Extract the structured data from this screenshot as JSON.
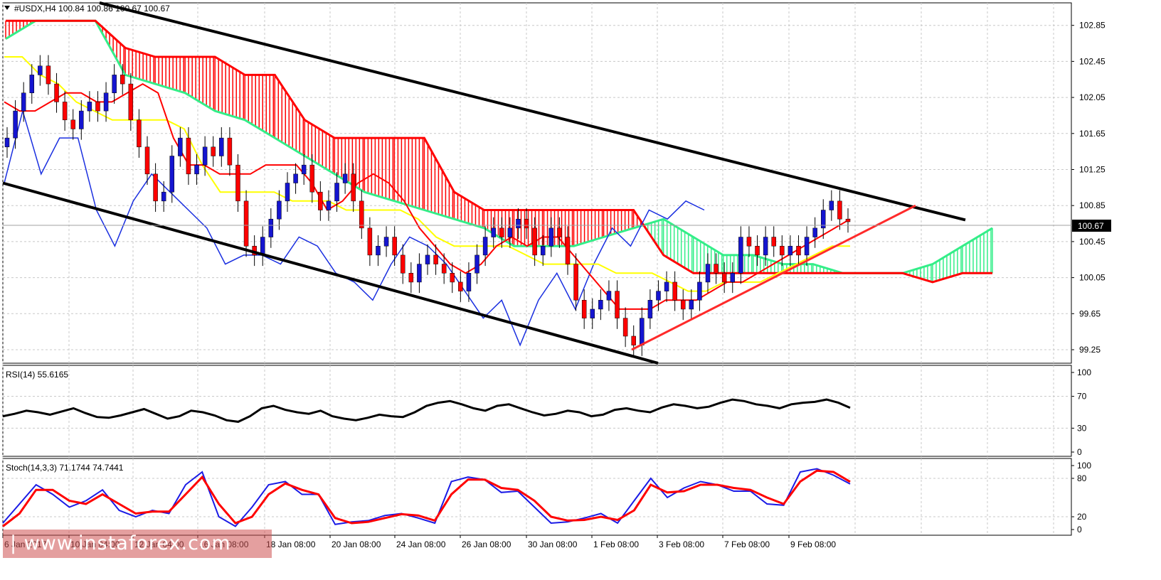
{
  "header": {
    "symbol_line": "#USDX,H4  100.84 100.86 100.67 100.67"
  },
  "colors": {
    "bull_candle": "#1515d0",
    "bear_candle": "#ff0000",
    "kumo_bear": "#ff0000",
    "kumo_bull": "#33ee88",
    "tenkan": "#ff0000",
    "kijun": "#ffff00",
    "chikou": "#1a2fe0",
    "channel": "#000000",
    "trendline": "#ff2a2a",
    "rsi_line": "#000000",
    "stoch_main": "#1a1ae6",
    "stoch_signal": "#ff0000"
  },
  "price_axis": {
    "ticks": [
      "102.85",
      "102.45",
      "102.05",
      "101.65",
      "101.25",
      "100.85",
      "100.45",
      "100.05",
      "99.65",
      "99.25"
    ],
    "current": "100.67"
  },
  "time_axis": [
    "6 Jan 2017",
    "10 Jan 04:00",
    "12 Jan 04:00",
    "16 Jan 08:00",
    "18 Jan 08:00",
    "20 Jan 08:00",
    "24 Jan 08:00",
    "26 Jan 08:00",
    "30 Jan 08:00",
    "1 Feb 08:00",
    "3 Feb 08:00",
    "7 Feb 08:00",
    "9 Feb 08:00"
  ],
  "rsi_panel": {
    "title": "RSI(14) 55.6165",
    "ticks": [
      "100",
      "70",
      "30",
      "0"
    ]
  },
  "stoch_panel": {
    "title": "Stoch(14,3,3) 71.1744 74.7441",
    "ticks": [
      "100",
      "80",
      "20",
      "0"
    ]
  },
  "watermark": "| www.instaforex.com",
  "chart_data": {
    "type": "candlestick",
    "symbol": "#USDX",
    "timeframe": "H4",
    "ohlc_last": {
      "open": 100.84,
      "high": 100.86,
      "low": 100.67,
      "close": 100.67
    },
    "ylim": [
      99.1,
      103.1
    ],
    "close_series": [
      101.6,
      101.9,
      102.1,
      102.3,
      102.4,
      102.2,
      102.0,
      101.8,
      101.7,
      101.9,
      102.0,
      101.9,
      102.1,
      102.3,
      102.2,
      101.8,
      101.5,
      101.2,
      100.9,
      101.0,
      101.4,
      101.6,
      101.2,
      101.3,
      101.5,
      101.4,
      101.6,
      101.3,
      100.9,
      100.4,
      100.3,
      100.5,
      100.7,
      100.9,
      101.1,
      101.2,
      101.3,
      101.0,
      100.8,
      100.9,
      101.1,
      101.2,
      100.9,
      100.6,
      100.3,
      100.4,
      100.5,
      100.3,
      100.1,
      100.0,
      100.2,
      100.3,
      100.2,
      100.1,
      100.0,
      99.9,
      100.1,
      100.3,
      100.5,
      100.6,
      100.5,
      100.6,
      100.7,
      100.6,
      100.3,
      100.4,
      100.6,
      100.5,
      100.2,
      99.8,
      99.6,
      99.7,
      99.8,
      99.9,
      99.6,
      99.4,
      99.3,
      99.6,
      99.8,
      99.9,
      100.0,
      99.8,
      99.7,
      99.8,
      100.0,
      100.2,
      100.1,
      100.0,
      100.1,
      100.5,
      100.4,
      100.3,
      100.5,
      100.4,
      100.3,
      100.4,
      100.3,
      100.5,
      100.6,
      100.8,
      100.9,
      100.7,
      100.67
    ],
    "tenkan": [
      102.0,
      101.9,
      101.9,
      102.0,
      102.1,
      102.1,
      102.0,
      102.0,
      102.1,
      102.2,
      102.1,
      101.6,
      101.3,
      101.3,
      101.2,
      101.2,
      101.2,
      101.3,
      101.3,
      101.3,
      101.1,
      100.8,
      100.9,
      101.1,
      101.2,
      101.1,
      100.9,
      100.6,
      100.4,
      100.2,
      100.1,
      100.2,
      100.4,
      100.5,
      100.4,
      100.5,
      100.5,
      100.3,
      100.1,
      99.9,
      99.7,
      99.7,
      99.7,
      99.8,
      99.8,
      99.8,
      99.9,
      100.0,
      100.0,
      100.1,
      100.2,
      100.3,
      100.4,
      100.5,
      100.6,
      100.7
    ],
    "kijun": [
      102.5,
      102.5,
      102.3,
      102.2,
      102.0,
      101.9,
      101.8,
      101.8,
      101.8,
      101.8,
      101.7,
      101.3,
      101.0,
      101.0,
      101.0,
      101.0,
      100.9,
      100.9,
      100.9,
      100.8,
      100.8,
      100.8,
      100.8,
      100.7,
      100.5,
      100.4,
      100.4,
      100.4,
      100.4,
      100.3,
      100.2,
      100.2,
      100.2,
      100.2,
      100.1,
      100.1,
      100.1,
      100.0,
      99.9,
      99.9,
      100.0,
      100.0,
      100.0,
      100.1,
      100.2,
      100.3,
      100.4,
      100.4
    ],
    "senkou_a": [
      102.7,
      102.9,
      102.9,
      102.9,
      102.3,
      102.2,
      102.1,
      101.9,
      101.8,
      101.6,
      101.4,
      101.2,
      101.0,
      100.9,
      100.8,
      100.7,
      100.6,
      100.4,
      100.4,
      100.4,
      100.5,
      100.6,
      100.7,
      100.5,
      100.3,
      100.3,
      100.2,
      100.2,
      100.1,
      100.1,
      100.1,
      100.2,
      100.4,
      100.6
    ],
    "senkou_b": [
      102.9,
      102.9,
      102.9,
      102.9,
      102.6,
      102.5,
      102.5,
      102.5,
      102.3,
      102.3,
      101.8,
      101.6,
      101.6,
      101.6,
      101.6,
      101.0,
      100.8,
      100.8,
      100.8,
      100.8,
      100.8,
      100.8,
      100.3,
      100.1,
      100.1,
      100.1,
      100.1,
      100.1,
      100.1,
      100.1,
      100.1,
      100.0,
      100.1,
      100.1
    ],
    "chikou": [
      101.1,
      101.9,
      101.2,
      101.6,
      101.6,
      100.8,
      100.4,
      100.9,
      101.2,
      101.0,
      100.8,
      100.6,
      100.2,
      100.3,
      100.3,
      100.2,
      100.5,
      100.4,
      100.1,
      100.0,
      99.8,
      100.2,
      100.5,
      100.4,
      100.2,
      99.9,
      99.6,
      99.8,
      99.3,
      99.8,
      100.1,
      99.7,
      100.2,
      100.6,
      100.4,
      100.8,
      100.7,
      100.9,
      100.8
    ],
    "channel_upper": {
      "from": [
        "6 Jan 2017",
        103.1
      ],
      "to": [
        "after 9 Feb 08:00",
        100.69
      ]
    },
    "channel_lower": {
      "from": [
        "6 Jan 2017",
        101.1
      ],
      "to": [
        "1 Feb 08:00",
        99.1
      ]
    },
    "support_trendline": {
      "from": [
        "1 Feb 08:00",
        99.25
      ],
      "to": [
        "9 Feb 08:00",
        100.85
      ]
    },
    "rsi": {
      "name": "RSI(14)",
      "last": 55.6165,
      "ylim": [
        0,
        100
      ],
      "values": [
        45,
        48,
        52,
        50,
        47,
        51,
        55,
        49,
        44,
        43,
        46,
        50,
        54,
        48,
        42,
        45,
        52,
        50,
        46,
        40,
        38,
        45,
        55,
        58,
        53,
        50,
        48,
        52,
        45,
        42,
        40,
        43,
        47,
        45,
        44,
        50,
        58,
        62,
        64,
        60,
        55,
        52,
        58,
        60,
        55,
        50,
        46,
        48,
        52,
        50,
        45,
        47,
        53,
        55,
        52,
        50,
        56,
        60,
        58,
        55,
        57,
        62,
        66,
        64,
        60,
        58,
        55,
        60,
        62,
        63,
        66,
        62,
        55.6
      ]
    },
    "stochastic": {
      "name": "Stoch(14,3,3)",
      "main_last": 71.1744,
      "signal_last": 74.7441,
      "ylim": [
        0,
        100
      ],
      "main": [
        10,
        40,
        70,
        55,
        35,
        45,
        62,
        30,
        20,
        30,
        25,
        70,
        90,
        20,
        5,
        35,
        70,
        75,
        55,
        55,
        8,
        12,
        14,
        22,
        25,
        18,
        10,
        75,
        82,
        78,
        58,
        60,
        35,
        10,
        12,
        18,
        25,
        10,
        45,
        80,
        50,
        65,
        75,
        70,
        60,
        60,
        40,
        38,
        90,
        95,
        85,
        71.2
      ],
      "signal": [
        5,
        25,
        62,
        62,
        45,
        40,
        55,
        40,
        25,
        28,
        28,
        55,
        82,
        40,
        10,
        20,
        55,
        72,
        62,
        55,
        18,
        10,
        12,
        18,
        24,
        22,
        14,
        55,
        78,
        78,
        65,
        62,
        45,
        20,
        14,
        15,
        20,
        15,
        30,
        70,
        58,
        60,
        70,
        70,
        65,
        62,
        50,
        40,
        75,
        92,
        90,
        74.7
      ]
    }
  }
}
